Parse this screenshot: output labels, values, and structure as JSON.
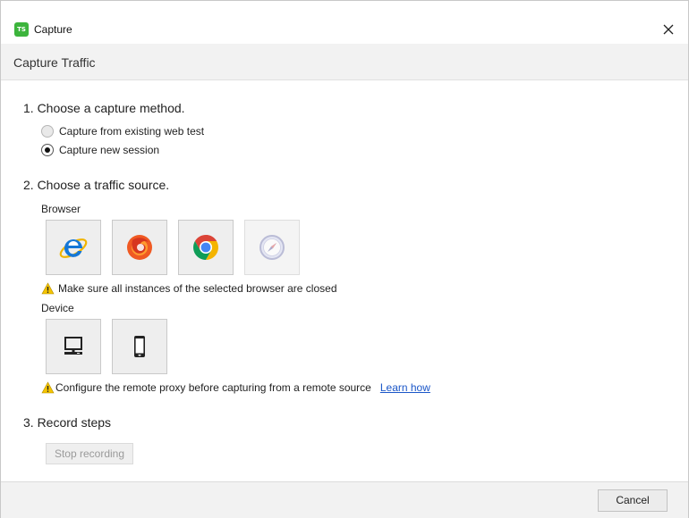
{
  "window": {
    "title": "Capture",
    "logo_text": "TS",
    "close_icon": "close-icon"
  },
  "header": {
    "title": "Capture Traffic"
  },
  "step1": {
    "title": "1. Choose a capture method.",
    "options": [
      {
        "label": "Capture from existing web test",
        "selected": false
      },
      {
        "label": "Capture new session",
        "selected": true
      }
    ]
  },
  "step2": {
    "title": "2. Choose a traffic source.",
    "browser_label": "Browser",
    "browsers": [
      {
        "icon": "internet-explorer-icon",
        "enabled": true
      },
      {
        "icon": "firefox-icon",
        "enabled": true
      },
      {
        "icon": "chrome-icon",
        "enabled": true
      },
      {
        "icon": "safari-icon",
        "enabled": false
      }
    ],
    "browser_warning": "Make sure all instances of the selected browser are closed",
    "device_label": "Device",
    "devices": [
      {
        "icon": "desktop-computer-icon",
        "enabled": true
      },
      {
        "icon": "mobile-phone-icon",
        "enabled": true
      }
    ],
    "device_warning": "Configure the remote proxy before capturing from a remote source",
    "learn_how": "Learn how"
  },
  "step3": {
    "title": "3. Record steps",
    "stop_label": "Stop recording"
  },
  "footer": {
    "cancel_label": "Cancel"
  },
  "colors": {
    "accent_link": "#1a56c8",
    "logo_green": "#3cb43c",
    "warning_yellow": "#f5c400"
  }
}
